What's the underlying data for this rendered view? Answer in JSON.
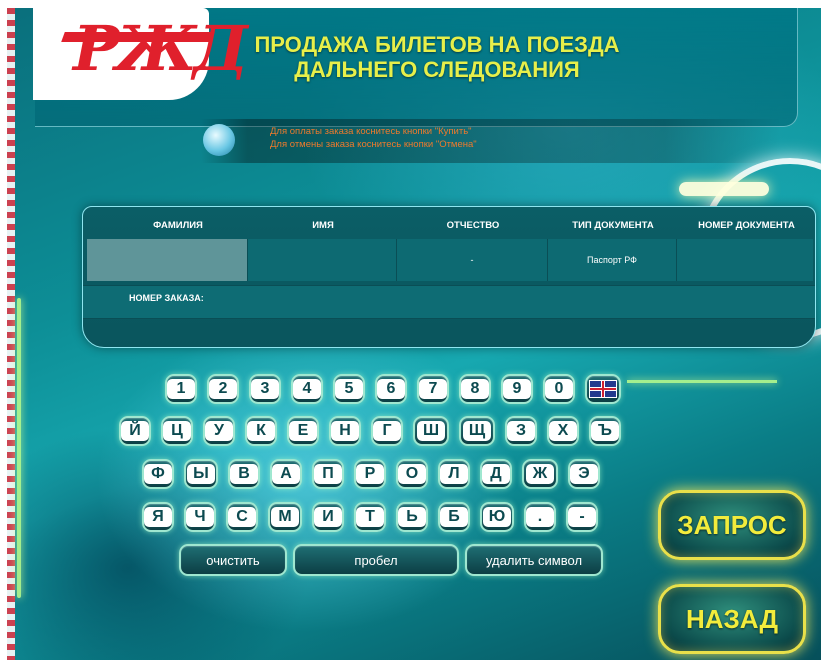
{
  "brand": {
    "logo_text": "РЖД"
  },
  "header": {
    "title_line1": "ПРОДАЖА БИЛЕТОВ НА ПОЕЗДА",
    "title_line2": "ДАЛЬНЕГО СЛЕДОВАНИЯ"
  },
  "info": {
    "line1": "Для оплаты заказа коснитесь кнопки \"Купить\"",
    "line2": "Для отмены заказа коснитесь кнопки \"Отмена\""
  },
  "table": {
    "headers": [
      "ФАМИЛИЯ",
      "ИМЯ",
      "ОТЧЕСТВО",
      "ТИП ДОКУМЕНТА",
      "НОМЕР ДОКУМЕНТА"
    ],
    "row": [
      "",
      "",
      "-",
      "Паспорт РФ",
      ""
    ],
    "order_label": "НОМЕР ЗАКАЗА:"
  },
  "keyboard": {
    "row1": [
      "1",
      "2",
      "3",
      "4",
      "5",
      "6",
      "7",
      "8",
      "9",
      "0"
    ],
    "lang_icon": "uk-flag-icon",
    "row2": [
      "Й",
      "Ц",
      "У",
      "К",
      "Е",
      "Н",
      "Г",
      "Ш",
      "Щ",
      "З",
      "Х",
      "Ъ"
    ],
    "row3": [
      "Ф",
      "Ы",
      "В",
      "А",
      "П",
      "Р",
      "О",
      "Л",
      "Д",
      "Ж",
      "Э"
    ],
    "row4": [
      "Я",
      "Ч",
      "С",
      "М",
      "И",
      "Т",
      "Ь",
      "Б",
      "Ю",
      ".",
      "-"
    ],
    "clear": "очистить",
    "space": "пробел",
    "delete": "удалить символ"
  },
  "actions": {
    "request": "ЗАПРОС",
    "back": "НАЗАД"
  },
  "colors": {
    "accent_yellow": "#E7EF4A",
    "brand_red": "#E0202C",
    "info_orange": "#EE7A2C",
    "panel_teal": "#0B5E66"
  }
}
